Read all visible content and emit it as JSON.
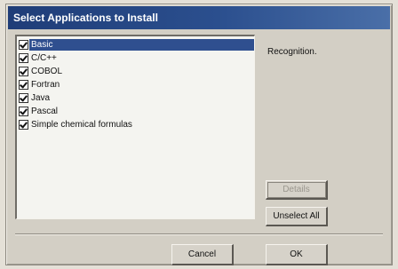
{
  "window": {
    "title": "Select Applications to Install"
  },
  "applications": [
    {
      "label": "Basic",
      "checked": true,
      "selected": true
    },
    {
      "label": "C/C++",
      "checked": true,
      "selected": false
    },
    {
      "label": "COBOL",
      "checked": true,
      "selected": false
    },
    {
      "label": "Fortran",
      "checked": true,
      "selected": false
    },
    {
      "label": "Java",
      "checked": true,
      "selected": false
    },
    {
      "label": "Pascal",
      "checked": true,
      "selected": false
    },
    {
      "label": "Simple chemical formulas",
      "checked": true,
      "selected": false
    }
  ],
  "description": "Recognition.",
  "buttons": {
    "details": "Details",
    "details_enabled": false,
    "unselect_all": "Unselect All",
    "cancel": "Cancel",
    "ok": "OK"
  },
  "colors": {
    "title_bar": "#2b4f8e",
    "selection": "#2f4f8f",
    "dialog_face": "#d3cfc5"
  }
}
